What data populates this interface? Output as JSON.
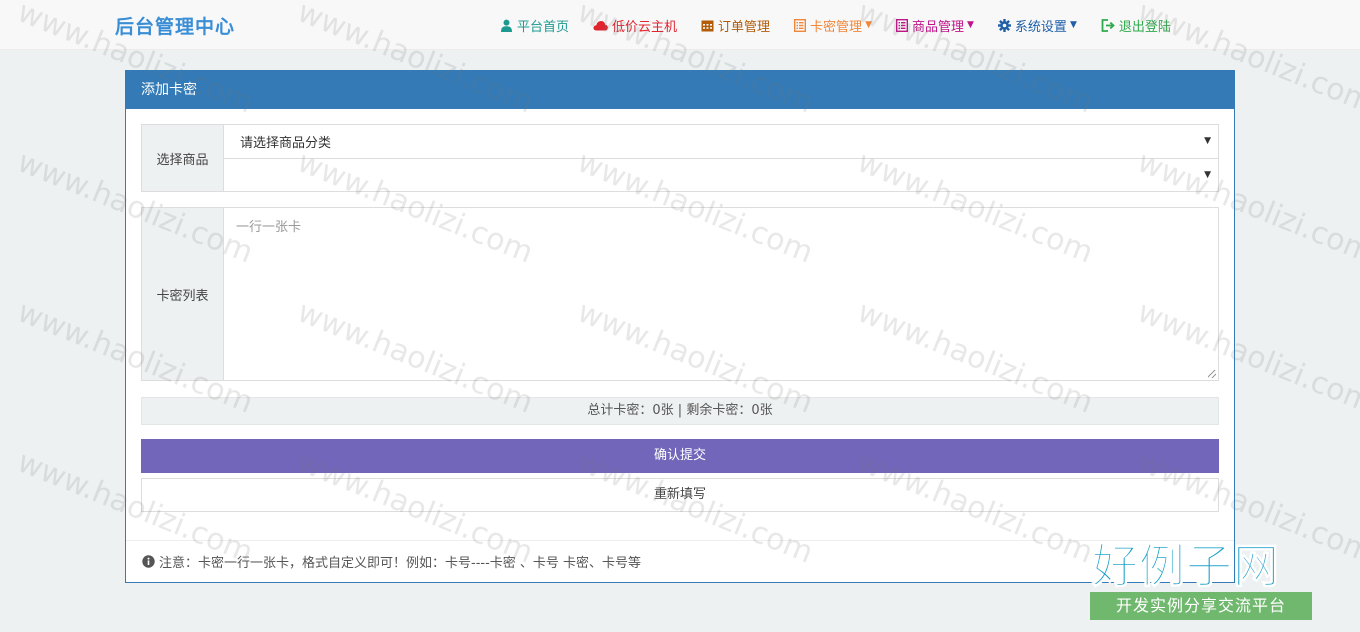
{
  "brand": "后台管理中心",
  "nav": [
    {
      "label": "平台首页",
      "icon": "user-icon",
      "color": "#1d9a8f",
      "dropdown": false
    },
    {
      "label": "低价云主机",
      "icon": "cloud-icon",
      "color": "#e0242e",
      "dropdown": false
    },
    {
      "label": "订单管理",
      "icon": "calendar-icon",
      "color": "#b25c08",
      "dropdown": false
    },
    {
      "label": "卡密管理",
      "icon": "list-icon",
      "color": "#f0873a",
      "dropdown": true
    },
    {
      "label": "商品管理",
      "icon": "list-icon",
      "color": "#c0138a",
      "dropdown": true
    },
    {
      "label": "系统设置",
      "icon": "gear-icon",
      "color": "#1e5fa8",
      "dropdown": true
    },
    {
      "label": "退出登陆",
      "icon": "logout-icon",
      "color": "#2faa4c",
      "dropdown": false
    }
  ],
  "panel": {
    "title": "添加卡密",
    "product_label": "选择商品",
    "category_select": {
      "value": "请选择商品分类"
    },
    "product_select": {
      "value": ""
    },
    "cards_label": "卡密列表",
    "cards_placeholder": "一行一张卡",
    "stats": "总计卡密：0张 | 剩余卡密：0张",
    "submit_label": "确认提交",
    "reset_label": "重新填写",
    "note": "注意：卡密一行一张卡，格式自定义即可！例如：卡号----卡密 、卡号 卡密、卡号等"
  },
  "watermark": "www.haolizi.com",
  "logo": {
    "title": "好例子网",
    "subtitle": "开发实例分享交流平台"
  },
  "colors": {
    "primary": "#337ab7",
    "submit": "#7266ba",
    "brand": "#3a8ed6"
  }
}
